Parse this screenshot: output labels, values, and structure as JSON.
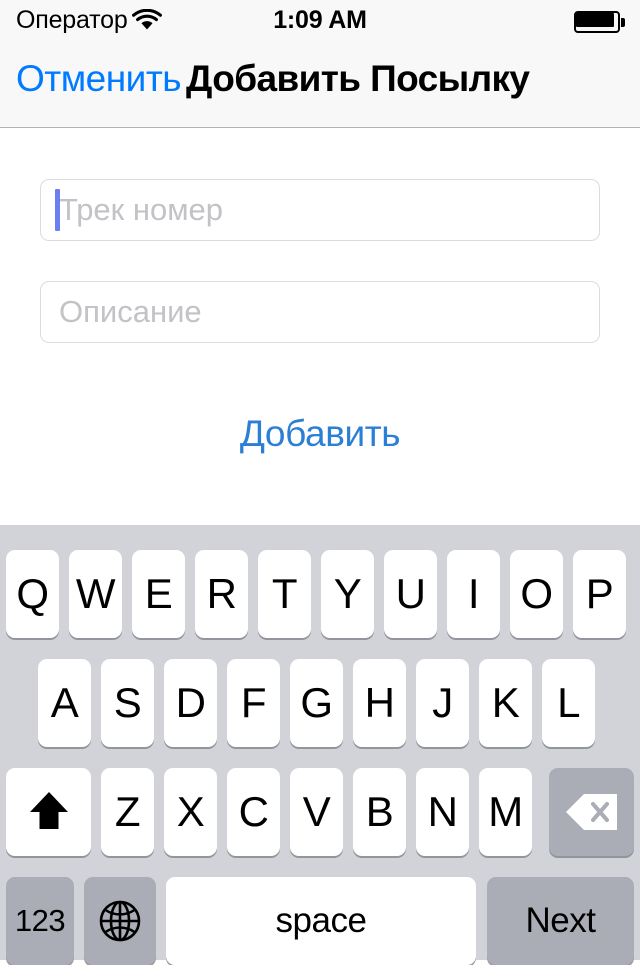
{
  "status_bar": {
    "carrier": "Оператор",
    "wifi_icon": "wifi-icon",
    "time": "1:09 AM",
    "battery_icon": "battery-full-icon"
  },
  "nav_bar": {
    "cancel_label": "Отменить",
    "title": "Добавить Посылку",
    "tint_color": "#007aff"
  },
  "form": {
    "tracking_field": {
      "placeholder": "Трек номер",
      "value": "",
      "focused": true,
      "caret_color": "#6c7ff2"
    },
    "description_field": {
      "placeholder": "Описание",
      "value": "",
      "focused": false
    },
    "add_button_label": "Добавить",
    "add_button_color": "#2b7fd4"
  },
  "keyboard": {
    "layout": "qwerty-uppercase",
    "background": "#d1d3d9",
    "rows": [
      {
        "keys": [
          "Q",
          "W",
          "E",
          "R",
          "T",
          "Y",
          "U",
          "I",
          "O",
          "P"
        ]
      },
      {
        "keys": [
          "A",
          "S",
          "D",
          "F",
          "G",
          "H",
          "J",
          "K",
          "L"
        ]
      },
      {
        "keys": [
          "Z",
          "X",
          "C",
          "V",
          "B",
          "N",
          "M"
        ]
      }
    ],
    "shift_key": {
      "icon": "shift-arrow-icon",
      "active": false
    },
    "backspace_key": {
      "icon": "backspace-delete-icon"
    },
    "numbers_key": {
      "label": "123"
    },
    "globe_key": {
      "icon": "globe-icon"
    },
    "space_key": {
      "label": "space"
    },
    "return_key": {
      "label": "Next"
    }
  }
}
